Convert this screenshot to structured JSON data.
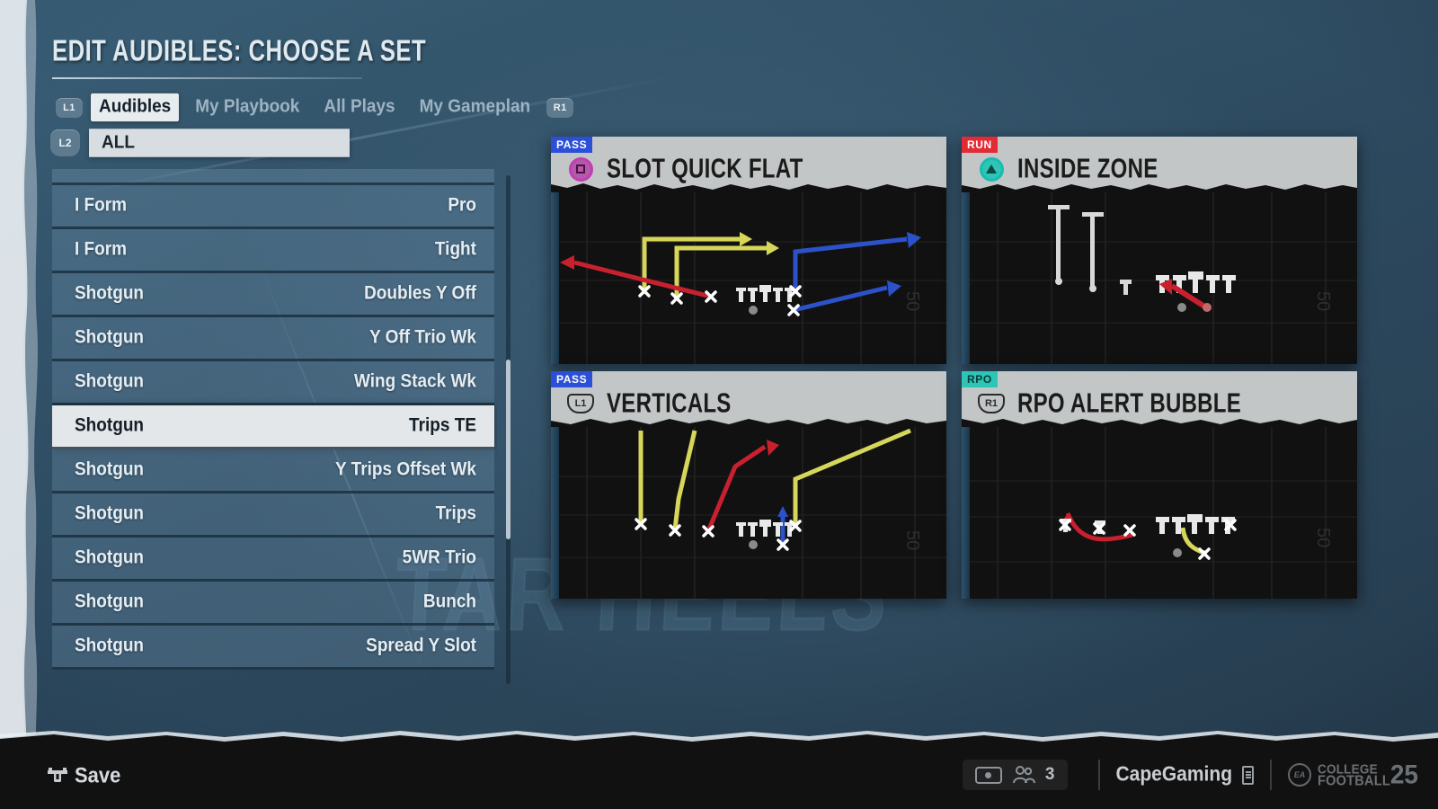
{
  "header": {
    "title": "EDIT AUDIBLES: CHOOSE A SET"
  },
  "tabs": {
    "left_bumper": "L1",
    "right_bumper": "R1",
    "items": [
      {
        "label": "Audibles",
        "active": true
      },
      {
        "label": "My Playbook",
        "active": false
      },
      {
        "label": "All Plays",
        "active": false
      },
      {
        "label": "My Gameplan",
        "active": false
      }
    ]
  },
  "filter": {
    "badge": "L2",
    "value": "ALL"
  },
  "formation_list": {
    "rows": [
      {
        "formation": "I Form",
        "set": "Pro",
        "selected": false
      },
      {
        "formation": "I Form",
        "set": "Tight",
        "selected": false
      },
      {
        "formation": "Shotgun",
        "set": "Doubles Y Off",
        "selected": false
      },
      {
        "formation": "Shotgun",
        "set": "Y Off Trio Wk",
        "selected": false
      },
      {
        "formation": "Shotgun",
        "set": "Wing Stack Wk",
        "selected": false
      },
      {
        "formation": "Shotgun",
        "set": "Trips TE",
        "selected": true
      },
      {
        "formation": "Shotgun",
        "set": "Y Trips Offset Wk",
        "selected": false
      },
      {
        "formation": "Shotgun",
        "set": "Trips",
        "selected": false
      },
      {
        "formation": "Shotgun",
        "set": "5WR Trio",
        "selected": false
      },
      {
        "formation": "Shotgun",
        "set": "Bunch",
        "selected": false
      },
      {
        "formation": "Shotgun",
        "set": "Spread Y Slot",
        "selected": false
      }
    ]
  },
  "play_cards": [
    {
      "badge": "PASS",
      "badge_color": "#2b4fd8",
      "title": "SLOT QUICK FLAT",
      "button_icon": "ps-square-icon",
      "button_label": "",
      "icon_color": "#b45aa8"
    },
    {
      "badge": "RUN",
      "badge_color": "#e22b35",
      "title": "INSIDE ZONE",
      "button_icon": "ps-triangle-icon",
      "button_label": "",
      "icon_color": "#2ec4b6"
    },
    {
      "badge": "PASS",
      "badge_color": "#2b4fd8",
      "title": "VERTICALS",
      "button_icon": "shoulder-l1-icon",
      "button_label": "L1",
      "icon_color": "#c3c6c6"
    },
    {
      "badge": "RPO",
      "badge_color": "#2ec4b6",
      "title": "RPO ALERT BUBBLE",
      "button_icon": "shoulder-r1-icon",
      "button_label": "R1",
      "icon_color": "#c3c6c6"
    }
  ],
  "footer": {
    "save_label": "Save",
    "save_icon": "dpad-button-icon",
    "touchpad_icon": "touchpad-icon",
    "people_icon": "players-icon",
    "people_count": "3",
    "gamertag": "CapeGaming",
    "battery_icon": "battery-icon",
    "logo": {
      "ea": "EA",
      "college": "COLLEGE",
      "football": "FOOTBALL",
      "year": "25"
    }
  },
  "background": {
    "watermark": "TAR HEELS"
  },
  "colors": {
    "field_bg": "#111111",
    "card_header": "#c3c6c6",
    "selected_row": "#e3e7ea",
    "page_bg": "#2e4a5e",
    "route_yellow": "#d6d65a",
    "route_red": "#c8202f",
    "route_blue": "#2b52c9",
    "player_white": "#e8e8e8"
  }
}
